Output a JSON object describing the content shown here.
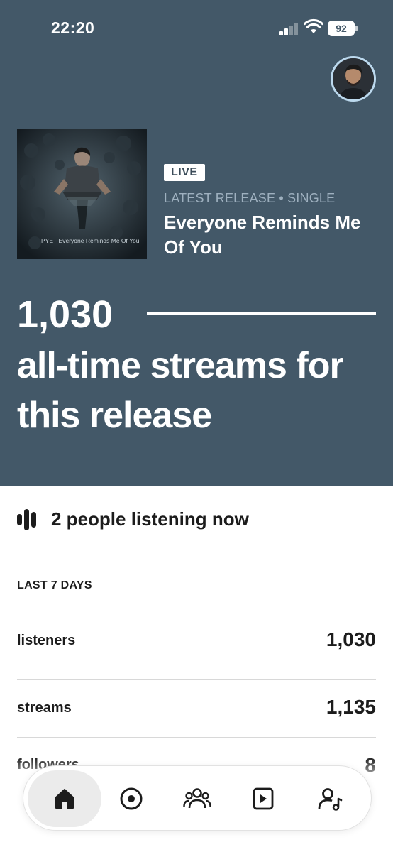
{
  "status_bar": {
    "time": "22:20",
    "battery": "92"
  },
  "release": {
    "cover_caption": "PYE · Everyone Reminds Me Of You",
    "badge": "LIVE",
    "meta": "LATEST RELEASE • SINGLE",
    "title": "Everyone Reminds Me Of You"
  },
  "summary": {
    "streams": "1,030",
    "caption": "all-time streams for this release"
  },
  "listening": {
    "text": "2 people listening now"
  },
  "stats": {
    "heading": "LAST 7 DAYS",
    "rows": [
      {
        "label": "listeners",
        "value": "1,030"
      },
      {
        "label": "streams",
        "value": "1,135"
      },
      {
        "label": "followers",
        "value": "8"
      }
    ]
  },
  "nav": {
    "items": [
      {
        "icon": "home-icon",
        "active": true
      },
      {
        "icon": "target-icon",
        "active": false
      },
      {
        "icon": "audience-icon",
        "active": false
      },
      {
        "icon": "music-icon",
        "active": false
      },
      {
        "icon": "profile-icon",
        "active": false
      }
    ]
  },
  "colors": {
    "hero_background": "#435868",
    "accent_ring": "#bcd9ee",
    "text_dark": "#1c1c1c"
  }
}
